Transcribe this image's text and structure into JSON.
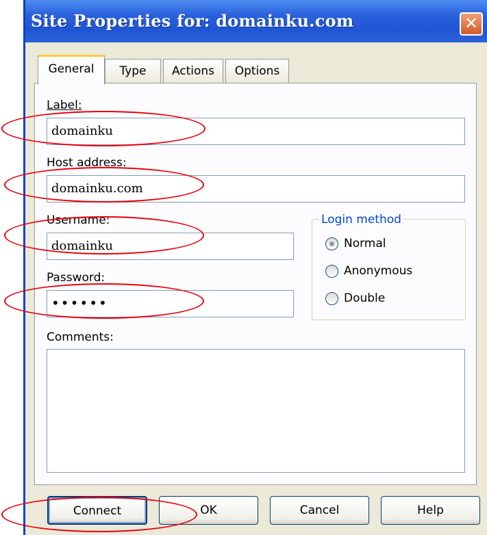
{
  "window": {
    "title": "Site Properties for: domainku.com"
  },
  "tabs": [
    "General",
    "Type",
    "Actions",
    "Options"
  ],
  "fields": {
    "label_caption": "Label:",
    "label_value": "domainku",
    "host_caption": "Host address:",
    "host_value": "domainku.com",
    "username_caption": "Username:",
    "username_value": "domainku",
    "password_caption": "Password:",
    "password_value": "••••••",
    "comments_caption": "Comments:",
    "comments_value": ""
  },
  "login_method": {
    "legend": "Login method",
    "options": [
      "Normal",
      "Anonymous",
      "Double"
    ],
    "selected": "Normal"
  },
  "buttons": {
    "connect": "Connect",
    "ok": "OK",
    "cancel": "Cancel",
    "help": "Help"
  },
  "colors": {
    "titlebar": "#2a62dd",
    "dialog_bg": "#ece9d8",
    "annotation": "#e8000b",
    "legend": "#0046d5"
  },
  "icons": {
    "close": "close-icon"
  }
}
